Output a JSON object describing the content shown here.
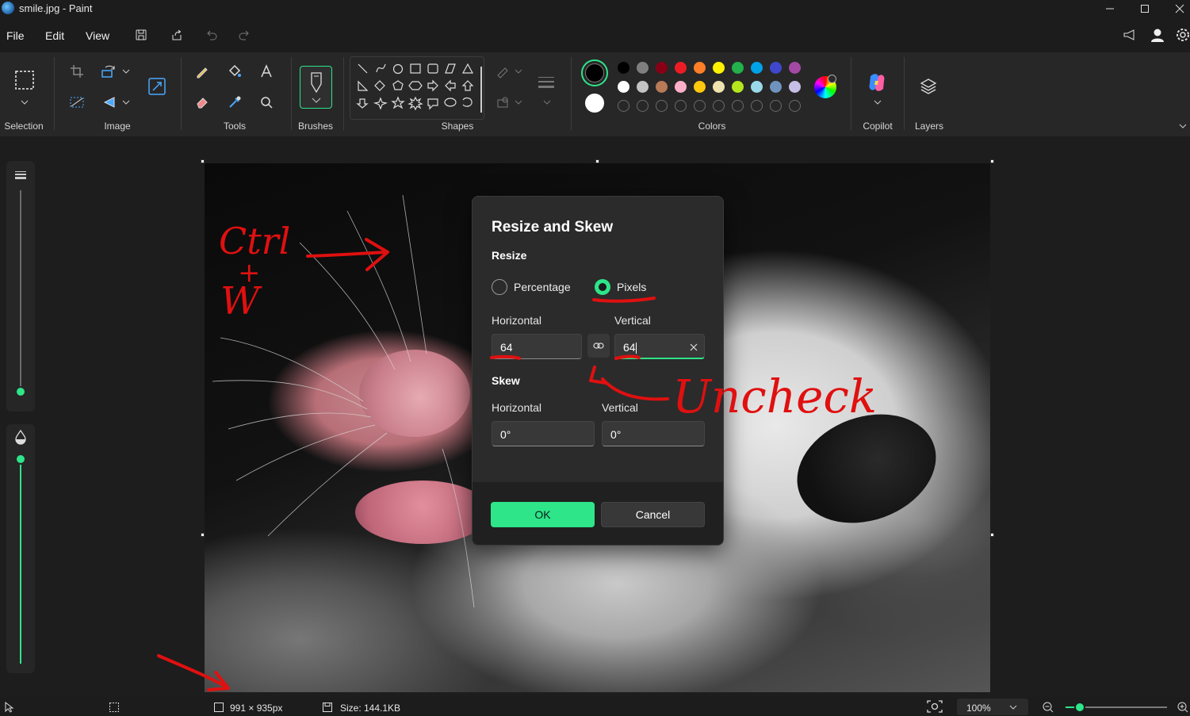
{
  "window": {
    "title": "smile.jpg - Paint",
    "controls": [
      "minimize",
      "maximize",
      "close"
    ]
  },
  "menu": {
    "items": [
      "File",
      "Edit",
      "View"
    ]
  },
  "ribbon": {
    "groups": {
      "selection": "Selection",
      "image": "Image",
      "tools": "Tools",
      "brushes": "Brushes",
      "shapes": "Shapes",
      "colors": "Colors",
      "copilot": "Copilot",
      "layers": "Layers"
    },
    "colors": {
      "primary": "#000000",
      "secondary": "#ffffff",
      "row1": [
        "#000000",
        "#7f7f7f",
        "#880015",
        "#ed1c24",
        "#ff7f27",
        "#fff200",
        "#22b14c",
        "#00a2e8",
        "#3f48cc",
        "#a349a4"
      ],
      "row2": [
        "#ffffff",
        "#c3c3c3",
        "#b97a57",
        "#ffaec9",
        "#ffc90e",
        "#efe4b0",
        "#b5e61d",
        "#99d9ea",
        "#7092be",
        "#c8bfe7"
      ]
    }
  },
  "dialog": {
    "title": "Resize and Skew",
    "resize_section": "Resize",
    "percentage_label": "Percentage",
    "pixels_label": "Pixels",
    "horizontal_label": "Horizontal",
    "vertical_label": "Vertical",
    "resize_horizontal_value": "64",
    "resize_vertical_value": "64",
    "skew_section": "Skew",
    "skew_horizontal_label": "Horizontal",
    "skew_vertical_label": "Vertical",
    "skew_horizontal_value": "0°",
    "skew_vertical_value": "0°",
    "ok_label": "OK",
    "cancel_label": "Cancel",
    "selected_mode": "Pixels"
  },
  "status": {
    "dimensions": "991 × 935px",
    "size": "Size: 144.1KB",
    "zoom": "100%"
  },
  "annotations": {
    "ctrl": "Ctrl",
    "plus": "+",
    "w": "W",
    "uncheck": "Uncheck",
    "color": "#e01010"
  },
  "accent": "#2ee58a"
}
